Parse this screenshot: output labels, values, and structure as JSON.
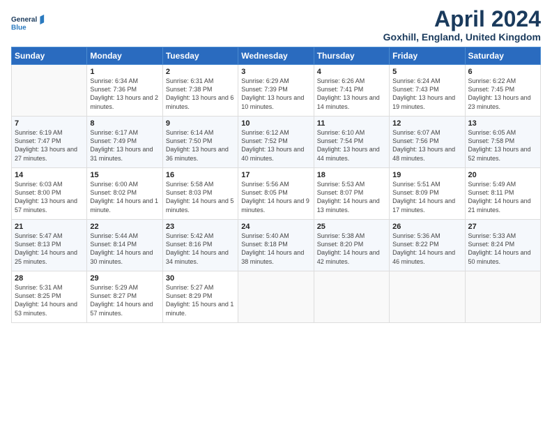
{
  "header": {
    "logo_line1": "General",
    "logo_line2": "Blue",
    "month_title": "April 2024",
    "location": "Goxhill, England, United Kingdom"
  },
  "weekdays": [
    "Sunday",
    "Monday",
    "Tuesday",
    "Wednesday",
    "Thursday",
    "Friday",
    "Saturday"
  ],
  "weeks": [
    [
      {
        "day": "",
        "sunrise": "",
        "sunset": "",
        "daylight": ""
      },
      {
        "day": "1",
        "sunrise": "6:34 AM",
        "sunset": "7:36 PM",
        "daylight": "13 hours and 2 minutes."
      },
      {
        "day": "2",
        "sunrise": "6:31 AM",
        "sunset": "7:38 PM",
        "daylight": "13 hours and 6 minutes."
      },
      {
        "day": "3",
        "sunrise": "6:29 AM",
        "sunset": "7:39 PM",
        "daylight": "13 hours and 10 minutes."
      },
      {
        "day": "4",
        "sunrise": "6:26 AM",
        "sunset": "7:41 PM",
        "daylight": "13 hours and 14 minutes."
      },
      {
        "day": "5",
        "sunrise": "6:24 AM",
        "sunset": "7:43 PM",
        "daylight": "13 hours and 19 minutes."
      },
      {
        "day": "6",
        "sunrise": "6:22 AM",
        "sunset": "7:45 PM",
        "daylight": "13 hours and 23 minutes."
      }
    ],
    [
      {
        "day": "7",
        "sunrise": "6:19 AM",
        "sunset": "7:47 PM",
        "daylight": "13 hours and 27 minutes."
      },
      {
        "day": "8",
        "sunrise": "6:17 AM",
        "sunset": "7:49 PM",
        "daylight": "13 hours and 31 minutes."
      },
      {
        "day": "9",
        "sunrise": "6:14 AM",
        "sunset": "7:50 PM",
        "daylight": "13 hours and 36 minutes."
      },
      {
        "day": "10",
        "sunrise": "6:12 AM",
        "sunset": "7:52 PM",
        "daylight": "13 hours and 40 minutes."
      },
      {
        "day": "11",
        "sunrise": "6:10 AM",
        "sunset": "7:54 PM",
        "daylight": "13 hours and 44 minutes."
      },
      {
        "day": "12",
        "sunrise": "6:07 AM",
        "sunset": "7:56 PM",
        "daylight": "13 hours and 48 minutes."
      },
      {
        "day": "13",
        "sunrise": "6:05 AM",
        "sunset": "7:58 PM",
        "daylight": "13 hours and 52 minutes."
      }
    ],
    [
      {
        "day": "14",
        "sunrise": "6:03 AM",
        "sunset": "8:00 PM",
        "daylight": "13 hours and 57 minutes."
      },
      {
        "day": "15",
        "sunrise": "6:00 AM",
        "sunset": "8:02 PM",
        "daylight": "14 hours and 1 minute."
      },
      {
        "day": "16",
        "sunrise": "5:58 AM",
        "sunset": "8:03 PM",
        "daylight": "14 hours and 5 minutes."
      },
      {
        "day": "17",
        "sunrise": "5:56 AM",
        "sunset": "8:05 PM",
        "daylight": "14 hours and 9 minutes."
      },
      {
        "day": "18",
        "sunrise": "5:53 AM",
        "sunset": "8:07 PM",
        "daylight": "14 hours and 13 minutes."
      },
      {
        "day": "19",
        "sunrise": "5:51 AM",
        "sunset": "8:09 PM",
        "daylight": "14 hours and 17 minutes."
      },
      {
        "day": "20",
        "sunrise": "5:49 AM",
        "sunset": "8:11 PM",
        "daylight": "14 hours and 21 minutes."
      }
    ],
    [
      {
        "day": "21",
        "sunrise": "5:47 AM",
        "sunset": "8:13 PM",
        "daylight": "14 hours and 25 minutes."
      },
      {
        "day": "22",
        "sunrise": "5:44 AM",
        "sunset": "8:14 PM",
        "daylight": "14 hours and 30 minutes."
      },
      {
        "day": "23",
        "sunrise": "5:42 AM",
        "sunset": "8:16 PM",
        "daylight": "14 hours and 34 minutes."
      },
      {
        "day": "24",
        "sunrise": "5:40 AM",
        "sunset": "8:18 PM",
        "daylight": "14 hours and 38 minutes."
      },
      {
        "day": "25",
        "sunrise": "5:38 AM",
        "sunset": "8:20 PM",
        "daylight": "14 hours and 42 minutes."
      },
      {
        "day": "26",
        "sunrise": "5:36 AM",
        "sunset": "8:22 PM",
        "daylight": "14 hours and 46 minutes."
      },
      {
        "day": "27",
        "sunrise": "5:33 AM",
        "sunset": "8:24 PM",
        "daylight": "14 hours and 50 minutes."
      }
    ],
    [
      {
        "day": "28",
        "sunrise": "5:31 AM",
        "sunset": "8:25 PM",
        "daylight": "14 hours and 53 minutes."
      },
      {
        "day": "29",
        "sunrise": "5:29 AM",
        "sunset": "8:27 PM",
        "daylight": "14 hours and 57 minutes."
      },
      {
        "day": "30",
        "sunrise": "5:27 AM",
        "sunset": "8:29 PM",
        "daylight": "15 hours and 1 minute."
      },
      {
        "day": "",
        "sunrise": "",
        "sunset": "",
        "daylight": ""
      },
      {
        "day": "",
        "sunrise": "",
        "sunset": "",
        "daylight": ""
      },
      {
        "day": "",
        "sunrise": "",
        "sunset": "",
        "daylight": ""
      },
      {
        "day": "",
        "sunrise": "",
        "sunset": "",
        "daylight": ""
      }
    ]
  ]
}
